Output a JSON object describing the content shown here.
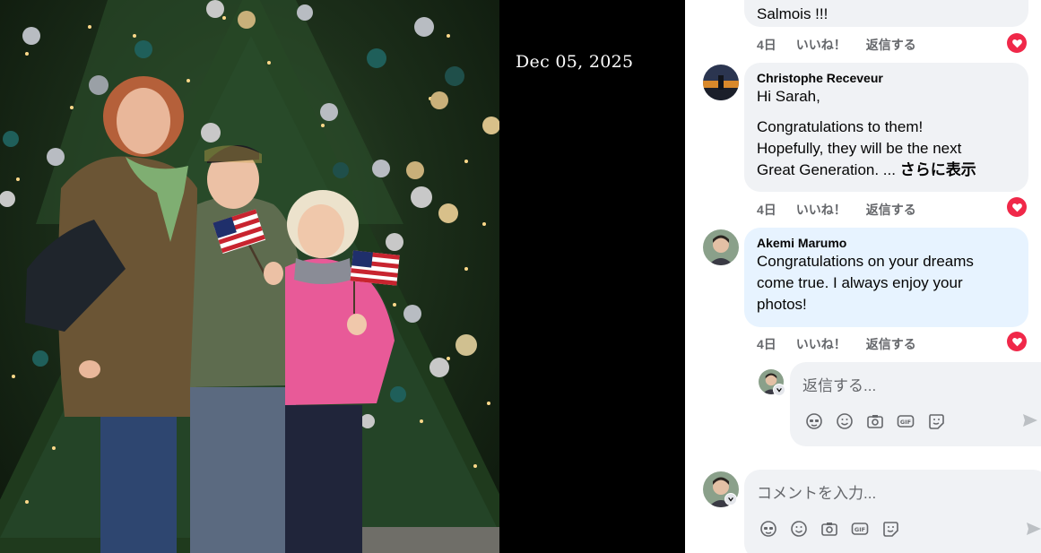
{
  "photo": {
    "date_stamp": "Dec 05, 2025"
  },
  "comments": [
    {
      "author": "",
      "text_lines": [
        "Salmois !!!"
      ],
      "age": "4日",
      "like_label": "いいね！",
      "reply_label": "返信する",
      "reaction": "love"
    },
    {
      "author": "Christophe Receveur",
      "text_lines": [
        "Hi Sarah,",
        "",
        "Congratulations to them!",
        "Hopefully, they will be the next",
        "Great Generation. ..."
      ],
      "see_more": "さらに表示",
      "age": "4日",
      "like_label": "いいね！",
      "reply_label": "返信する",
      "reaction": "love"
    },
    {
      "author": "Akemi Marumo",
      "text_lines": [
        "Congratulations on your dreams",
        "come true. I always enjoy your",
        "photos!"
      ],
      "age": "4日",
      "like_label": "いいね！",
      "reply_label": "返信する",
      "reaction": "love"
    }
  ],
  "reply_composer": {
    "placeholder": "返信する..."
  },
  "comment_composer": {
    "placeholder": "コメントを入力..."
  },
  "composer_tools": [
    "avatar-sticker-icon",
    "emoji-icon",
    "camera-icon",
    "gif-icon",
    "sticker-icon"
  ],
  "colors": {
    "reaction_red": "#f02849",
    "bubble_bg": "#f0f2f5",
    "bubble_highlight": "#e7f3ff",
    "meta_text": "#65676b"
  }
}
